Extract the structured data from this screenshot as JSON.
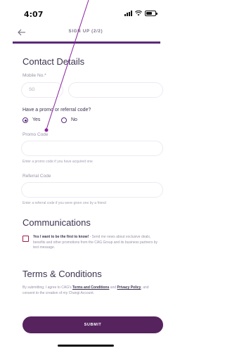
{
  "status_bar": {
    "time": "4:07"
  },
  "nav": {
    "title": "SIGN UP (2/2)"
  },
  "progress": {
    "fraction": 1.0,
    "color": "#5a2a78"
  },
  "contact": {
    "heading": "Contact Details",
    "mobile_label": "Mobile No.*",
    "country_code": "SG",
    "mobile_value": ""
  },
  "promo": {
    "question": "Have a promo or referral code?",
    "yes_label": "Yes",
    "no_label": "No",
    "selected": "Yes",
    "promo_label": "Promo Code",
    "promo_value": "",
    "promo_helper": "Enter a promo code if you have acquired one",
    "referral_label": "Referral Code",
    "referral_value": "",
    "referral_helper": "Enter a referral code if you were given one by a friend"
  },
  "communications": {
    "heading": "Communications",
    "checked": false,
    "consent_bold": "Yes I want to be the first to know!",
    "consent_rest": " - Send me news about exclusive deals, benefits and other promotions from the CAG Group and its business partners by text message."
  },
  "terms": {
    "heading": "Terms & Conditions",
    "text_1": "By submitting, I agree to CAG's ",
    "link_1": "Terms and Conditions",
    "text_2": " and ",
    "link_2": "Privacy Policy",
    "text_3": ", and consent to the creation of my Changi Account."
  },
  "submit": {
    "label": "SUBMIT"
  },
  "colors": {
    "primary": "#56235f",
    "annotation_line": "#8a1fa0",
    "checkbox_border": "#a01c4c"
  }
}
